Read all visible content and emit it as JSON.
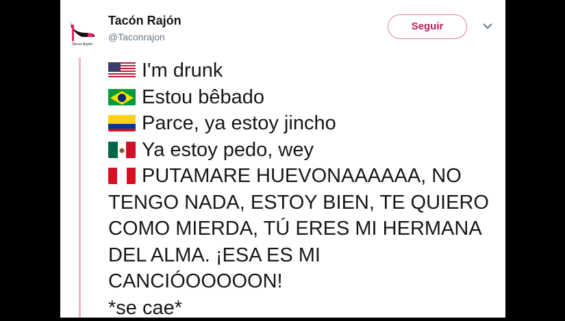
{
  "tweet": {
    "author_name": "Tacón Rajón",
    "author_handle": "@Taconrajon",
    "follow_label": "Seguir",
    "avatar_text": "Tacon Rajón",
    "lines": [
      {
        "flag": "us-flag-icon",
        "text": "I'm drunk"
      },
      {
        "flag": "br-flag-icon",
        "text": "Estou bêbado"
      },
      {
        "flag": "co-flag-icon",
        "text": "Parce, ya estoy jincho"
      },
      {
        "flag": "mx-flag-icon",
        "text": "Ya estoy pedo, wey"
      },
      {
        "flag": "pe-flag-icon",
        "text": "PUTAMARE HUEVONAAAAAA, NO TENGO NADA, ESTOY BIEN, TE QUIERO COMO MIERDA, TÚ ERES MI HERMANA DEL ALMA. ¡ESA ES MI CANCIÓOOOOON!"
      },
      {
        "flag": "",
        "text": "*se cae*"
      }
    ]
  },
  "colors": {
    "accent": "#c2185b",
    "thread_line": "#f2b5c8"
  },
  "icons": [
    "high-heel-avatar-icon",
    "chevron-down-icon"
  ]
}
